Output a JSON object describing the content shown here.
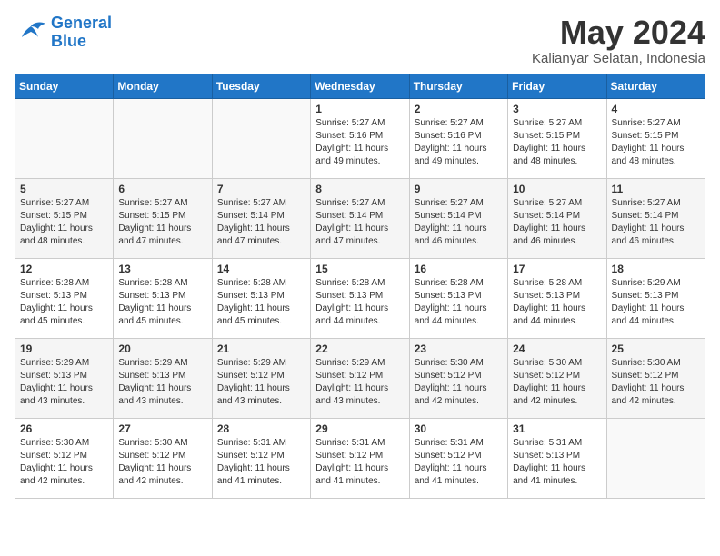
{
  "header": {
    "logo_line1": "General",
    "logo_line2": "Blue",
    "month": "May 2024",
    "location": "Kalianyar Selatan, Indonesia"
  },
  "days_of_week": [
    "Sunday",
    "Monday",
    "Tuesday",
    "Wednesday",
    "Thursday",
    "Friday",
    "Saturday"
  ],
  "weeks": [
    [
      {
        "num": "",
        "info": ""
      },
      {
        "num": "",
        "info": ""
      },
      {
        "num": "",
        "info": ""
      },
      {
        "num": "1",
        "info": "Sunrise: 5:27 AM\nSunset: 5:16 PM\nDaylight: 11 hours\nand 49 minutes."
      },
      {
        "num": "2",
        "info": "Sunrise: 5:27 AM\nSunset: 5:16 PM\nDaylight: 11 hours\nand 49 minutes."
      },
      {
        "num": "3",
        "info": "Sunrise: 5:27 AM\nSunset: 5:15 PM\nDaylight: 11 hours\nand 48 minutes."
      },
      {
        "num": "4",
        "info": "Sunrise: 5:27 AM\nSunset: 5:15 PM\nDaylight: 11 hours\nand 48 minutes."
      }
    ],
    [
      {
        "num": "5",
        "info": "Sunrise: 5:27 AM\nSunset: 5:15 PM\nDaylight: 11 hours\nand 48 minutes."
      },
      {
        "num": "6",
        "info": "Sunrise: 5:27 AM\nSunset: 5:15 PM\nDaylight: 11 hours\nand 47 minutes."
      },
      {
        "num": "7",
        "info": "Sunrise: 5:27 AM\nSunset: 5:14 PM\nDaylight: 11 hours\nand 47 minutes."
      },
      {
        "num": "8",
        "info": "Sunrise: 5:27 AM\nSunset: 5:14 PM\nDaylight: 11 hours\nand 47 minutes."
      },
      {
        "num": "9",
        "info": "Sunrise: 5:27 AM\nSunset: 5:14 PM\nDaylight: 11 hours\nand 46 minutes."
      },
      {
        "num": "10",
        "info": "Sunrise: 5:27 AM\nSunset: 5:14 PM\nDaylight: 11 hours\nand 46 minutes."
      },
      {
        "num": "11",
        "info": "Sunrise: 5:27 AM\nSunset: 5:14 PM\nDaylight: 11 hours\nand 46 minutes."
      }
    ],
    [
      {
        "num": "12",
        "info": "Sunrise: 5:28 AM\nSunset: 5:13 PM\nDaylight: 11 hours\nand 45 minutes."
      },
      {
        "num": "13",
        "info": "Sunrise: 5:28 AM\nSunset: 5:13 PM\nDaylight: 11 hours\nand 45 minutes."
      },
      {
        "num": "14",
        "info": "Sunrise: 5:28 AM\nSunset: 5:13 PM\nDaylight: 11 hours\nand 45 minutes."
      },
      {
        "num": "15",
        "info": "Sunrise: 5:28 AM\nSunset: 5:13 PM\nDaylight: 11 hours\nand 44 minutes."
      },
      {
        "num": "16",
        "info": "Sunrise: 5:28 AM\nSunset: 5:13 PM\nDaylight: 11 hours\nand 44 minutes."
      },
      {
        "num": "17",
        "info": "Sunrise: 5:28 AM\nSunset: 5:13 PM\nDaylight: 11 hours\nand 44 minutes."
      },
      {
        "num": "18",
        "info": "Sunrise: 5:29 AM\nSunset: 5:13 PM\nDaylight: 11 hours\nand 44 minutes."
      }
    ],
    [
      {
        "num": "19",
        "info": "Sunrise: 5:29 AM\nSunset: 5:13 PM\nDaylight: 11 hours\nand 43 minutes."
      },
      {
        "num": "20",
        "info": "Sunrise: 5:29 AM\nSunset: 5:13 PM\nDaylight: 11 hours\nand 43 minutes."
      },
      {
        "num": "21",
        "info": "Sunrise: 5:29 AM\nSunset: 5:12 PM\nDaylight: 11 hours\nand 43 minutes."
      },
      {
        "num": "22",
        "info": "Sunrise: 5:29 AM\nSunset: 5:12 PM\nDaylight: 11 hours\nand 43 minutes."
      },
      {
        "num": "23",
        "info": "Sunrise: 5:30 AM\nSunset: 5:12 PM\nDaylight: 11 hours\nand 42 minutes."
      },
      {
        "num": "24",
        "info": "Sunrise: 5:30 AM\nSunset: 5:12 PM\nDaylight: 11 hours\nand 42 minutes."
      },
      {
        "num": "25",
        "info": "Sunrise: 5:30 AM\nSunset: 5:12 PM\nDaylight: 11 hours\nand 42 minutes."
      }
    ],
    [
      {
        "num": "26",
        "info": "Sunrise: 5:30 AM\nSunset: 5:12 PM\nDaylight: 11 hours\nand 42 minutes."
      },
      {
        "num": "27",
        "info": "Sunrise: 5:30 AM\nSunset: 5:12 PM\nDaylight: 11 hours\nand 42 minutes."
      },
      {
        "num": "28",
        "info": "Sunrise: 5:31 AM\nSunset: 5:12 PM\nDaylight: 11 hours\nand 41 minutes."
      },
      {
        "num": "29",
        "info": "Sunrise: 5:31 AM\nSunset: 5:12 PM\nDaylight: 11 hours\nand 41 minutes."
      },
      {
        "num": "30",
        "info": "Sunrise: 5:31 AM\nSunset: 5:12 PM\nDaylight: 11 hours\nand 41 minutes."
      },
      {
        "num": "31",
        "info": "Sunrise: 5:31 AM\nSunset: 5:13 PM\nDaylight: 11 hours\nand 41 minutes."
      },
      {
        "num": "",
        "info": ""
      }
    ]
  ]
}
